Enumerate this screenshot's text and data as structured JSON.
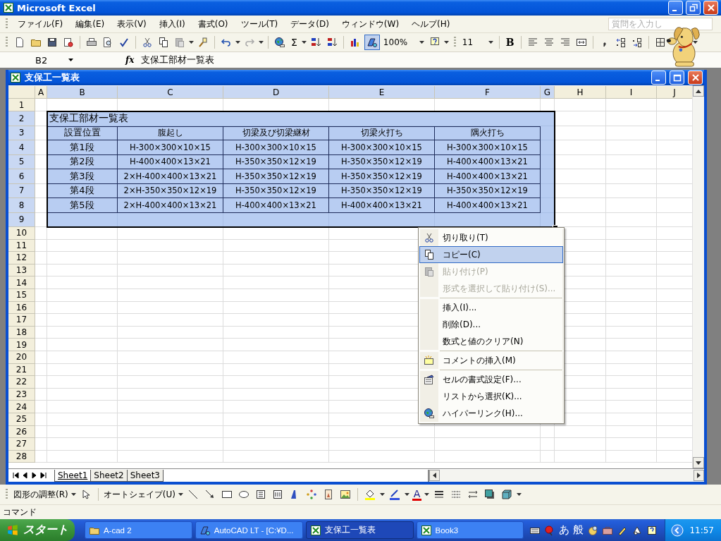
{
  "app": {
    "title": "Microsoft Excel"
  },
  "menus": [
    "ファイル(F)",
    "編集(E)",
    "表示(V)",
    "挿入(I)",
    "書式(O)",
    "ツール(T)",
    "データ(D)",
    "ウィンドウ(W)",
    "ヘルプ(H)"
  ],
  "help_box": {
    "placeholder": "質問を入力し"
  },
  "toolbar": {
    "autosum": "Σ",
    "zoom": "100%",
    "font_size": "11",
    "bold": "B"
  },
  "formula_bar": {
    "name_box": "B2",
    "function_label": "fx",
    "formula": "支保工部材一覧表"
  },
  "workbook": {
    "title": "支保工一覧表",
    "columns": [
      {
        "label": "A",
        "selected": false
      },
      {
        "label": "B",
        "selected": true
      },
      {
        "label": "C",
        "selected": true
      },
      {
        "label": "D",
        "selected": true
      },
      {
        "label": "E",
        "selected": true
      },
      {
        "label": "F",
        "selected": true
      },
      {
        "label": "G",
        "selected": true
      },
      {
        "label": "H",
        "selected": false
      },
      {
        "label": "I",
        "selected": false
      },
      {
        "label": "J",
        "selected": false
      }
    ],
    "rows": [
      {
        "label": "1",
        "selected": false
      },
      {
        "label": "2",
        "selected": true
      },
      {
        "label": "3",
        "selected": true
      },
      {
        "label": "4",
        "selected": true
      },
      {
        "label": "5",
        "selected": true
      },
      {
        "label": "6",
        "selected": true
      },
      {
        "label": "7",
        "selected": true
      },
      {
        "label": "8",
        "selected": true
      },
      {
        "label": "9",
        "selected": true
      },
      {
        "label": "10",
        "selected": false
      },
      {
        "label": "11",
        "selected": false
      },
      {
        "label": "12",
        "selected": false
      },
      {
        "label": "13",
        "selected": false
      },
      {
        "label": "14",
        "selected": false
      },
      {
        "label": "15",
        "selected": false
      },
      {
        "label": "16",
        "selected": false
      },
      {
        "label": "17",
        "selected": false
      },
      {
        "label": "18",
        "selected": false
      },
      {
        "label": "19",
        "selected": false
      },
      {
        "label": "20",
        "selected": false
      },
      {
        "label": "21",
        "selected": false
      },
      {
        "label": "22",
        "selected": false
      },
      {
        "label": "23",
        "selected": false
      },
      {
        "label": "24",
        "selected": false
      },
      {
        "label": "25",
        "selected": false
      },
      {
        "label": "26",
        "selected": false
      },
      {
        "label": "27",
        "selected": false
      },
      {
        "label": "28",
        "selected": false
      }
    ],
    "table": {
      "title": "支保工部材一覧表",
      "header": [
        "設置位置",
        "腹起し",
        "切梁及び切梁継材",
        "切梁火打ち",
        "隅火打ち"
      ],
      "rows": [
        [
          "第1段",
          "H-300×300×10×15",
          "H-300×300×10×15",
          "H-300×300×10×15",
          "H-300×300×10×15"
        ],
        [
          "第2段",
          "H-400×400×13×21",
          "H-350×350×12×19",
          "H-350×350×12×19",
          "H-400×400×13×21"
        ],
        [
          "第3段",
          "2×H-400×400×13×21",
          "H-350×350×12×19",
          "H-350×350×12×19",
          "H-400×400×13×21"
        ],
        [
          "第4段",
          "2×H-350×350×12×19",
          "H-350×350×12×19",
          "H-350×350×12×19",
          "H-350×350×12×19"
        ],
        [
          "第5段",
          "2×H-400×400×13×21",
          "H-400×400×13×21",
          "H-400×400×13×21",
          "H-400×400×13×21"
        ]
      ]
    },
    "sheets": [
      {
        "label": "Sheet1",
        "selected": true
      },
      {
        "label": "Sheet2",
        "selected": false
      },
      {
        "label": "Sheet3",
        "selected": false
      }
    ]
  },
  "context_menu": {
    "sections": [
      [
        {
          "label": "切り取り(T)",
          "disabled": false,
          "selected": false
        },
        {
          "label": "コピー(C)",
          "disabled": false,
          "selected": true
        },
        {
          "label": "貼り付け(P)",
          "disabled": true,
          "selected": false
        },
        {
          "label": "形式を選択して貼り付け(S)...",
          "disabled": true,
          "selected": false
        }
      ],
      [
        {
          "label": "挿入(I)...",
          "disabled": false,
          "selected": false
        },
        {
          "label": "削除(D)...",
          "disabled": false,
          "selected": false
        },
        {
          "label": "数式と値のクリア(N)",
          "disabled": false,
          "selected": false
        }
      ],
      [
        {
          "label": "コメントの挿入(M)",
          "disabled": false,
          "selected": false
        }
      ],
      [
        {
          "label": "セルの書式設定(F)...",
          "disabled": false,
          "selected": false
        },
        {
          "label": "リストから選択(K)...",
          "disabled": false,
          "selected": false
        },
        {
          "label": "ハイパーリンク(H)...",
          "disabled": false,
          "selected": false
        }
      ]
    ]
  },
  "drawing_toolbar": {
    "draw_menu": "図形の調整(R)",
    "autoshapes_menu": "オートシェイプ(U)",
    "font_color": "A"
  },
  "status_bar": {
    "text": "コマンド"
  },
  "taskbar": {
    "start": "スタート",
    "tasks": [
      {
        "label": "A-cad 2",
        "selected": false
      },
      {
        "label": "AutoCAD LT - [C:¥D...",
        "selected": false
      },
      {
        "label": "支保工一覧表",
        "selected": true
      },
      {
        "label": "Book3",
        "selected": false
      }
    ],
    "ime": [
      "あ",
      "般"
    ],
    "clock": "11:57"
  }
}
